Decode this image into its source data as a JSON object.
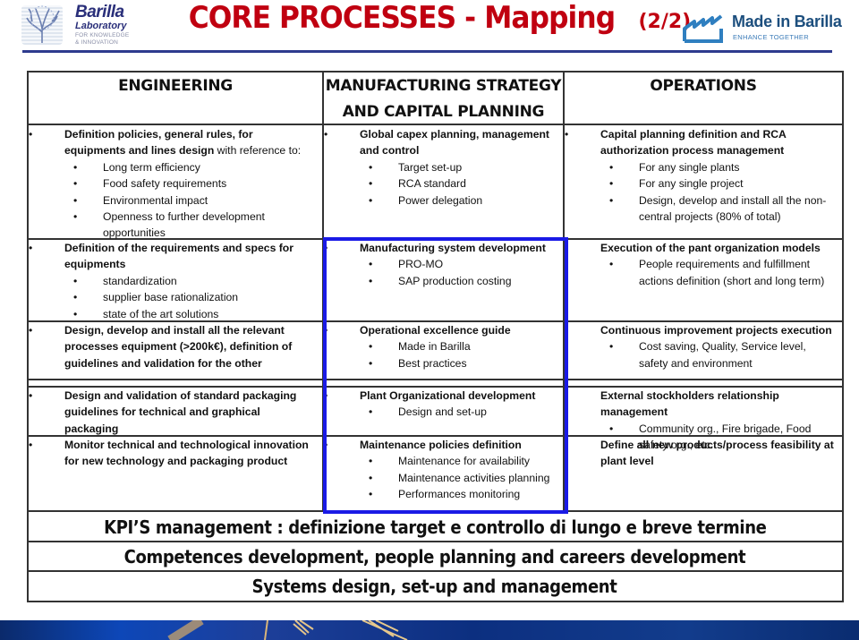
{
  "header": {
    "logo_left": {
      "line1": "Barilla",
      "line2": "Laboratory",
      "line3": "FOR KNOWLEDGE",
      "line4": "& INNOVATION",
      "icon": "tree-icon"
    },
    "title": "CORE PROCESSES - Mapping",
    "title_suffix": "(2/2)",
    "logo_right": {
      "line1": "Made in Barilla",
      "line2": "ENHANCE TOGETHER",
      "icon": "factory-roof-icon"
    }
  },
  "colors": {
    "title": "#c00010",
    "header_rule": "#2e3b8e",
    "highlight_box": "#1a1ae6",
    "table_border": "#333333"
  },
  "columns": [
    {
      "header_lines": [
        "ENGINEERING"
      ],
      "rows": [
        {
          "items": [
            {
              "bold": "Definition policies, general rules,  for equipments and lines design",
              "normal": " with reference to:",
              "subitems": [
                "Long term efficiency",
                "Food safety requirements",
                "Environmental impact",
                "Openness to further development opportunities"
              ]
            }
          ]
        },
        {
          "items": [
            {
              "bold": "Definition of the requirements and specs for equipments",
              "normal": "",
              "subitems": [
                "standardization",
                "supplier base rationalization",
                "state of the art solutions"
              ]
            }
          ]
        },
        {
          "items": [
            {
              "bold": "Design, develop and install all the relevant processes equipment  (>200k€), definition of guidelines and validation for the other",
              "normal": "",
              "subitems": []
            }
          ]
        },
        {
          "items": [
            {
              "bold": "Design and validation of standard packaging guidelines for technical and graphical packaging",
              "normal": "",
              "subitems": []
            }
          ]
        },
        {
          "items": [
            {
              "bold": "Monitor technical  and technological  innovation for new technology and  packaging product",
              "normal": "",
              "subitems": []
            }
          ]
        }
      ]
    },
    {
      "header_lines": [
        "MANUFACTURING STRATEGY",
        "AND CAPITAL PLANNING"
      ],
      "rows": [
        {
          "items": [
            {
              "bold": "Global capex planning, management and control",
              "normal": "",
              "subitems": [
                "Target set-up",
                "RCA standard",
                "Power delegation"
              ]
            }
          ]
        },
        {
          "items": [
            {
              "bold": "Manufacturing system development",
              "normal": "",
              "subitems": [
                "PRO-MO",
                "SAP production costing"
              ]
            }
          ]
        },
        {
          "items": [
            {
              "bold": "Operational  excellence guide",
              "normal": "",
              "subitems": [
                "Made in Barilla",
                "Best practices"
              ]
            }
          ]
        },
        {
          "items": [
            {
              "bold": "Plant Organizational development",
              "normal": "",
              "subitems": [
                "Design and set-up"
              ]
            }
          ]
        },
        {
          "items": [
            {
              "bold": "Maintenance policies definition",
              "normal": "",
              "subitems": [
                "Maintenance for availability",
                "Maintenance activities planning",
                "Performances monitoring"
              ]
            }
          ]
        }
      ]
    },
    {
      "header_lines": [
        "OPERATIONS"
      ],
      "rows": [
        {
          "items": [
            {
              "bold": "Capital planning definition and RCA authorization process management",
              "normal": "",
              "subitems": [
                "For any single plants",
                "For any single project",
                "Design, develop and install all the non-central projects (80% of total)"
              ]
            }
          ]
        },
        {
          "items": [
            {
              "bold": "Execution of the pant organization models",
              "normal": "",
              "subitems": [
                "People requirements and  fulfillment actions definition (short and long term)"
              ]
            }
          ]
        },
        {
          "items": [
            {
              "bold": "Continuous improvement projects execution",
              "normal": "",
              "subitems": [
                "Cost saving, Quality, Service level, safety and environment"
              ]
            }
          ]
        },
        {
          "items": [
            {
              "bold": "External stockholders relationship management",
              "normal": "",
              "subitems": [
                "Community org., Fire brigade, Food safety  org., etc."
              ]
            }
          ]
        },
        {
          "items": [
            {
              "bold": "Define all new products/process feasibility at plant level",
              "normal": "",
              "subitems": []
            }
          ]
        }
      ]
    }
  ],
  "bands": [
    "KPI’S management : definizione target e controllo di lungo e breve termine",
    "Competences development, people planning and careers development",
    "Systems design, set-up and  management"
  ],
  "bullet": "•"
}
